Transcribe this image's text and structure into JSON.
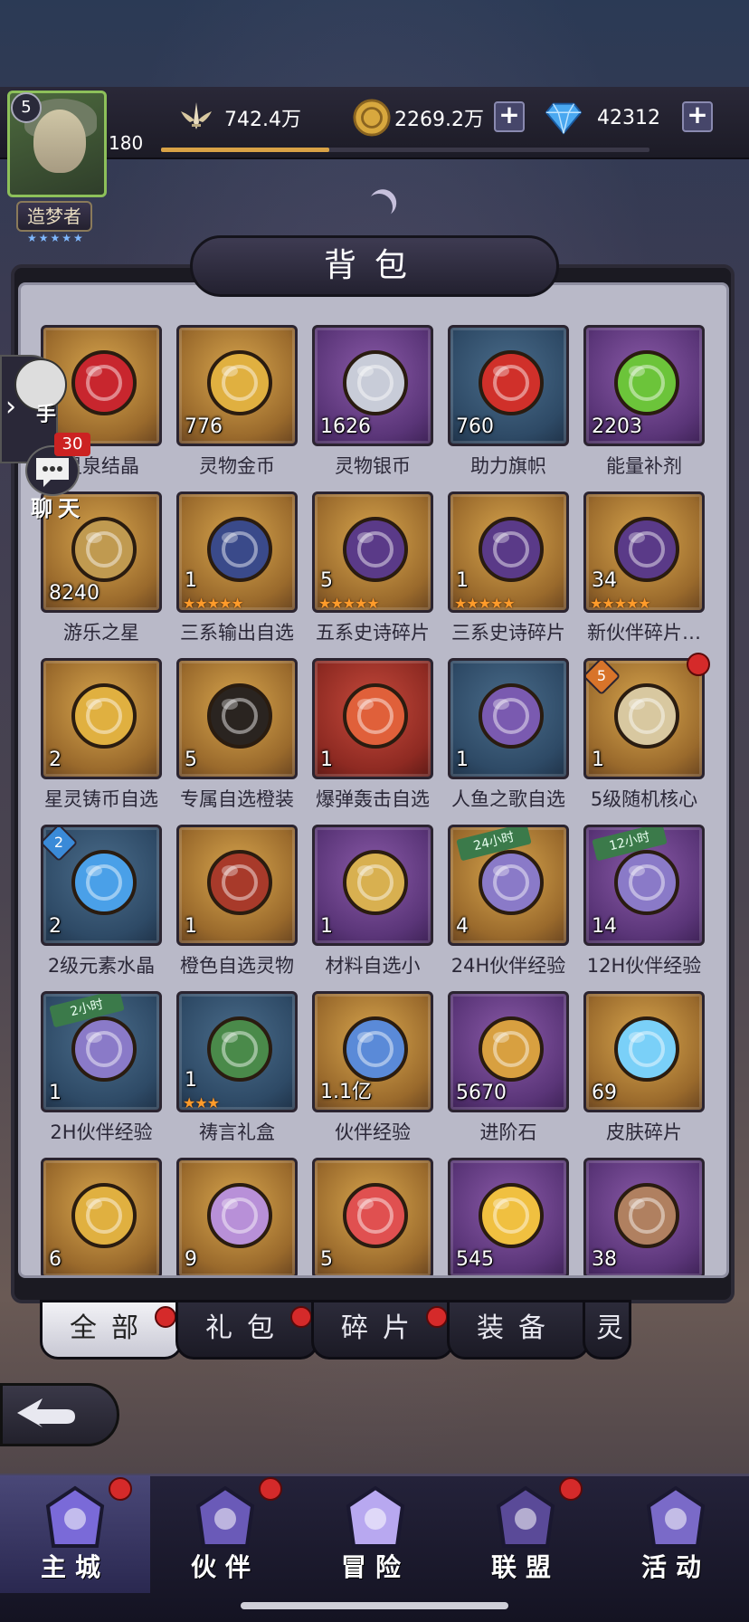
{
  "player": {
    "level": "5",
    "vip": "180",
    "title": "造梦者",
    "title_stars": "★★★★★"
  },
  "resources": {
    "power": "742.4万",
    "gold": "2269.2万",
    "gems": "42312"
  },
  "panel": {
    "title": "背包"
  },
  "side": {
    "helper_label": "手",
    "chat_label": "聊天",
    "chat_badge": "30"
  },
  "items": [
    {
      "name": "灵泉结晶",
      "qty": "",
      "bg": "gold",
      "icon": "red-crystal-icon",
      "color": "#c8262e"
    },
    {
      "name": "灵物金币",
      "qty": "776",
      "bg": "gold",
      "icon": "gold-coin-icon",
      "color": "#e0b040"
    },
    {
      "name": "灵物银币",
      "qty": "1626",
      "bg": "purple",
      "icon": "silver-coin-icon",
      "color": "#c8ccd8"
    },
    {
      "name": "助力旗帜",
      "qty": "760",
      "bg": "blue",
      "icon": "red-flag-icon",
      "color": "#d0302a"
    },
    {
      "name": "能量补剂",
      "qty": "2203",
      "bg": "purple",
      "icon": "green-potion-icon",
      "color": "#6cc43a"
    },
    {
      "name": "游乐之星",
      "qty": "8240",
      "bg": "gold",
      "icon": "bronze-coin-icon",
      "color": "#c09a50"
    },
    {
      "name": "三系输出自选",
      "qty": "1",
      "bg": "gold",
      "icon": "card-pack-icon",
      "color": "#3a4a8a",
      "stars": "★★★★★"
    },
    {
      "name": "五系史诗碎片",
      "qty": "5",
      "bg": "gold",
      "icon": "treasure-chest-icon",
      "color": "#5a3a88",
      "stars": "★★★★★"
    },
    {
      "name": "三系史诗碎片",
      "qty": "1",
      "bg": "gold",
      "icon": "treasure-chest-icon",
      "color": "#5a3a88",
      "stars": "★★★★★"
    },
    {
      "name": "新伙伴碎片…",
      "qty": "34",
      "bg": "gold",
      "icon": "treasure-chest-icon",
      "color": "#5a3a88",
      "stars": "★★★★★"
    },
    {
      "name": "星灵铸币自选",
      "qty": "2",
      "bg": "gold",
      "icon": "emblem-coin-icon",
      "color": "#e0b040"
    },
    {
      "name": "专属自选橙装",
      "qty": "5",
      "bg": "gold",
      "icon": "magnifier-silhouette-icon",
      "color": "#2a2420"
    },
    {
      "name": "爆弹轰击自选",
      "qty": "1",
      "bg": "red",
      "icon": "hero-portrait-icon",
      "color": "#e0603a"
    },
    {
      "name": "人鱼之歌自选",
      "qty": "1",
      "bg": "blue",
      "icon": "mermaid-portrait-icon",
      "color": "#7a5ab0"
    },
    {
      "name": "5级随机核心",
      "qty": "1",
      "bg": "gold",
      "icon": "coin-bag-icon",
      "color": "#d8c8a0",
      "badge": "5",
      "dot": true
    },
    {
      "name": "2级元素水晶",
      "qty": "2",
      "bg": "blue",
      "icon": "crystal-ball-icon",
      "color": "#4aa0e8",
      "badge": "2"
    },
    {
      "name": "橙色自选灵物",
      "qty": "1",
      "bg": "gold",
      "icon": "gift-box-icon",
      "color": "#a83a2a"
    },
    {
      "name": "材料自选小",
      "qty": "1",
      "bg": "purple",
      "icon": "open-gift-icon",
      "color": "#d8b050"
    },
    {
      "name": "24H伙伴经验",
      "qty": "4",
      "bg": "gold",
      "icon": "exp-gift-icon",
      "color": "#8a7ac8",
      "ribbon": "24小时"
    },
    {
      "name": "12H伙伴经验",
      "qty": "14",
      "bg": "purple",
      "icon": "exp-gift-icon",
      "color": "#8a7ac8",
      "ribbon": "12小时"
    },
    {
      "name": "2H伙伴经验",
      "qty": "1",
      "bg": "blue",
      "icon": "exp-gift-icon",
      "color": "#8a7ac8",
      "ribbon": "2小时"
    },
    {
      "name": "祷言礼盒",
      "qty": "1",
      "bg": "blue",
      "icon": "green-chest-icon",
      "color": "#4a8a4a",
      "stars": "★★★"
    },
    {
      "name": "伙伴经验",
      "qty": "1.1亿",
      "bg": "gold",
      "icon": "exp-star-icon",
      "color": "#5a8ad8"
    },
    {
      "name": "进阶石",
      "qty": "5670",
      "bg": "purple",
      "icon": "amber-stone-icon",
      "color": "#d8a040"
    },
    {
      "name": "皮肤碎片",
      "qty": "69",
      "bg": "gold",
      "icon": "blue-gem-icon",
      "color": "#7ad0f8"
    },
    {
      "name": "",
      "qty": "6",
      "bg": "gold",
      "icon": "golden-scroll-icon",
      "color": "#e0b040"
    },
    {
      "name": "",
      "qty": "9",
      "bg": "gold",
      "icon": "star-medallion-icon",
      "color": "#b890d8"
    },
    {
      "name": "",
      "qty": "5",
      "bg": "gold",
      "icon": "heart-gem-icon",
      "color": "#e05050"
    },
    {
      "name": "",
      "qty": "545",
      "bg": "purple",
      "icon": "music-note-icon",
      "color": "#f0c040"
    },
    {
      "name": "",
      "qty": "38",
      "bg": "purple",
      "icon": "scroll-bundle-icon",
      "color": "#b08060"
    }
  ],
  "tabs": [
    {
      "label": "全部",
      "active": true,
      "dot": true
    },
    {
      "label": "礼包",
      "active": false,
      "dot": true
    },
    {
      "label": "碎片",
      "active": false,
      "dot": true
    },
    {
      "label": "装备",
      "active": false,
      "dot": false
    },
    {
      "label": "灵",
      "active": false,
      "dot": false
    }
  ],
  "nav": [
    {
      "label": "主城",
      "active": true,
      "dot": true,
      "icon": "castle-icon",
      "color": "#7a6ad8"
    },
    {
      "label": "伙伴",
      "active": false,
      "dot": true,
      "icon": "witch-hat-icon",
      "color": "#6a5ab8"
    },
    {
      "label": "冒险",
      "active": false,
      "dot": false,
      "icon": "compass-orb-icon",
      "color": "#b8a8f0"
    },
    {
      "label": "联盟",
      "active": false,
      "dot": true,
      "icon": "shield-crest-icon",
      "color": "#5a4a98"
    },
    {
      "label": "活动",
      "active": false,
      "dot": false,
      "icon": "cards-icon",
      "color": "#7a6ac8"
    }
  ]
}
